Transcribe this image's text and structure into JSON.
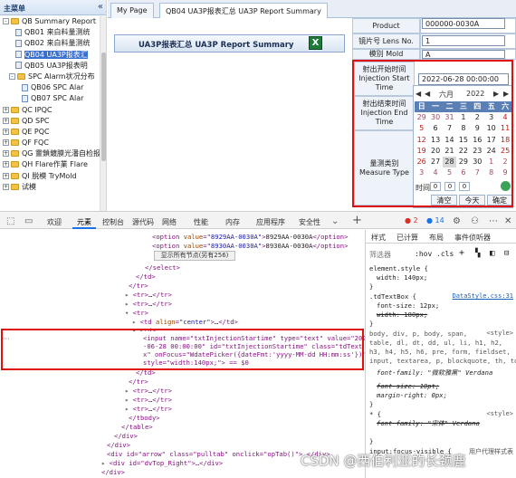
{
  "sidebar": {
    "title": "主菜单",
    "collapse_icon": "«",
    "items": [
      {
        "label": "QB Summary Report",
        "type": "folder",
        "indent": 0,
        "exp": "-"
      },
      {
        "label": "QB01 来白料量测统",
        "type": "doc",
        "indent": 2
      },
      {
        "label": "QB02 来白料量测统",
        "type": "doc",
        "indent": 2
      },
      {
        "label": "QB04 UA3P报表汇",
        "type": "doc",
        "indent": 2,
        "selected": true
      },
      {
        "label": "QB05 UA3P报表明",
        "type": "doc",
        "indent": 2
      },
      {
        "label": "SPC Alarm状况分布",
        "type": "folder",
        "indent": 1,
        "exp": "-"
      },
      {
        "label": "QB06 SPC Alar",
        "type": "doc",
        "indent": 3
      },
      {
        "label": "QB07 SPC Alar",
        "type": "doc",
        "indent": 3
      },
      {
        "label": "QC IPQC",
        "type": "folder",
        "indent": 0,
        "exp": "+"
      },
      {
        "label": "QD SPC",
        "type": "folder",
        "indent": 0,
        "exp": "+"
      },
      {
        "label": "QE PQC",
        "type": "folder",
        "indent": 0,
        "exp": "+"
      },
      {
        "label": "QF FQC",
        "type": "folder",
        "indent": 0,
        "exp": "+"
      },
      {
        "label": "QG 靈鎖鍍膜光潘自检报",
        "type": "folder",
        "indent": 0,
        "exp": "+"
      },
      {
        "label": "QH Flare作業 Flare",
        "type": "folder",
        "indent": 0,
        "exp": "+"
      },
      {
        "label": "QI 脱模 TryMold",
        "type": "folder",
        "indent": 0,
        "exp": "+"
      },
      {
        "label": "试模",
        "type": "folder",
        "indent": 0,
        "exp": "+"
      }
    ]
  },
  "tabs": [
    "My Page",
    "QB04 UA3P报表汇总 UA3P Report Summary"
  ],
  "report": {
    "title": "UA3P报表汇总 UA3P Report Summary",
    "export_icon": "excel-icon",
    "export_glyph": "X"
  },
  "form": {
    "product_label": "Product",
    "product_value": "000000-0030A",
    "lens_label": "镜片号 Lens No.",
    "lens_value": "1",
    "mold_label": "模别 Mold",
    "mold_value": "A",
    "start_label": "射出开始时间 Injection Start Time",
    "start_value": "2022-06-28 00:00:00",
    "end_label": "射出结束时间 Injection End Time",
    "measure_label": "量测类别 Measure Type"
  },
  "calendar": {
    "prev_year": "◀",
    "prev_month": "◀",
    "month": "六月",
    "year": "2022",
    "next_month": "▶",
    "next_year": "▶",
    "weekdays": [
      "日",
      "一",
      "二",
      "三",
      "四",
      "五",
      "六"
    ],
    "weeks": [
      [
        "29",
        "30",
        "31",
        "1",
        "2",
        "3",
        "4"
      ],
      [
        "5",
        "6",
        "7",
        "8",
        "9",
        "10",
        "11"
      ],
      [
        "12",
        "13",
        "14",
        "15",
        "16",
        "17",
        "18"
      ],
      [
        "19",
        "20",
        "21",
        "22",
        "23",
        "24",
        "25"
      ],
      [
        "26",
        "27",
        "28",
        "29",
        "30",
        "1",
        "2"
      ],
      [
        "3",
        "4",
        "5",
        "6",
        "7",
        "8",
        "9"
      ]
    ],
    "time_label": "时间",
    "time_h": "0",
    "time_m": "0",
    "time_s": "0",
    "clear": "清空",
    "today": "今天",
    "ok": "确定"
  },
  "devtools": {
    "tabs": [
      "欢迎",
      "元素",
      "控制台",
      "源代码",
      "网络",
      "性能",
      "内存",
      "应用程序",
      "安全性"
    ],
    "errors": "2",
    "warnings": "14",
    "add": "+"
  },
  "elements": {
    "option1": {
      "value": "8929AA-0030A",
      "text": "8929AA-0030A"
    },
    "option2": {
      "value": "8930AA-0030A",
      "text": "8930AA-0030A"
    },
    "show_all": "显示所有节点(另有256)",
    "input_line1a": "<input name=\"txtInjectionStartime\" type=\"text\" value=\"202",
    "input_line2": "-06-28 00:00:00\" id=\"txtInjectionStartime\" class=\"tdText",
    "input_line3": "x\" onFocus=\"WdatePicker({dateFmt:'yyyy-MM-dd HH:mm:ss'})\"",
    "input_line4": "style=\"width:140px;\"> == $0",
    "arrow_div": "<div id=\"arrow\" class=\"pulltab\" onclick=\"opTab()\"> </div>",
    "right_div": "<div id=\"dvTop_Right\">…</div>"
  },
  "styles": {
    "tabs": [
      "样式",
      "已计算",
      "布局",
      "事件侦听器"
    ],
    "filter": "筛选器",
    "hov": ":hov",
    "cls": ".cls",
    "element_style": "element.style {",
    "element_width": "width: 140px;",
    "rule1": ".tdTextBox {",
    "rule1_src": "DataStyle.css:31",
    "rule1_fs": "font-size: 12px;",
    "rule1_w": "width: 180px;",
    "rule2": "body, div, p, body, span,",
    "rule2b": "table, dl, dt, dd, ul, li, h1, h2,",
    "rule2c": "h3, h4, h5, h6, pre, form, fieldset,",
    "rule2d": "input, textarea, p, blockquote, th, td",
    "rule2_src": "<style>",
    "ff": "font-family: \"微软雅黑\" Verdana",
    "fs": "font-size: 10pt;",
    "mt": "margin-right: 0px;",
    "rule3": "* {",
    "rule3_src": "<style>",
    "ff3": "font-family: \"宋体\" Verdana",
    "rule4": "input:focus-visible {",
    "rule4_src": "用户代理样式表"
  },
  "watermark": "CSDN @西伯利亚的长颈鹿"
}
